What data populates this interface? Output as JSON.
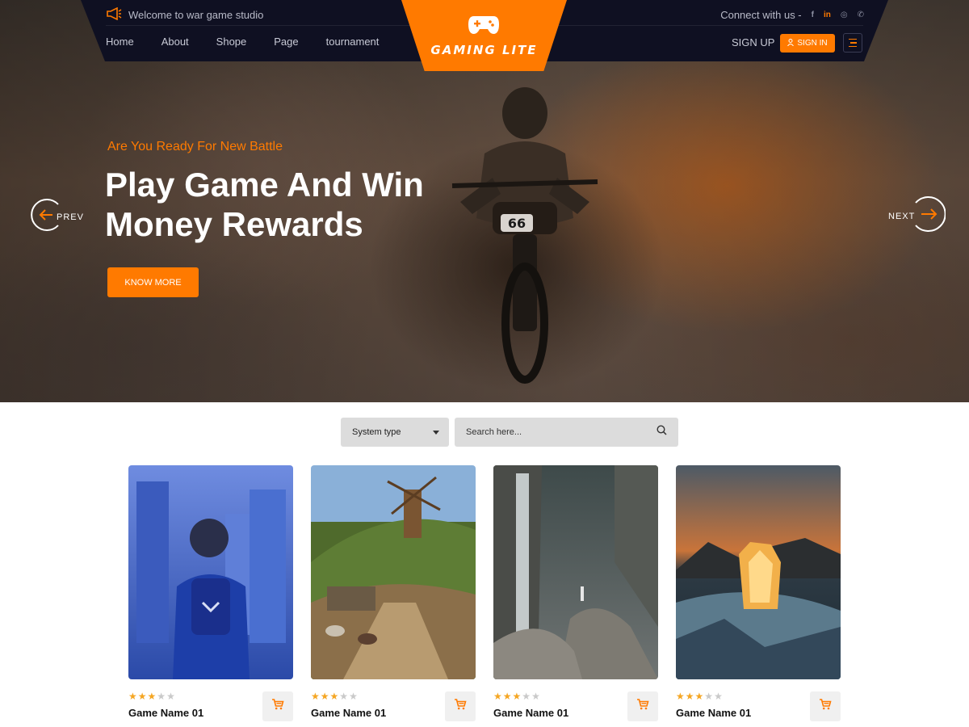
{
  "topbar": {
    "welcome": "Welcome to war game studio",
    "connect": "Connect with us -",
    "social": [
      "f",
      "in",
      "◎",
      "✆"
    ]
  },
  "nav": {
    "items": [
      "Home",
      "About",
      "Shope",
      "Page",
      "tournament"
    ],
    "signup": "SIGN UP",
    "signin": "SIGN IN"
  },
  "logo": {
    "text": "GAMING LITE"
  },
  "hero": {
    "kicker": "Are You Ready For New Battle",
    "headline_line1": "Play Game And Win",
    "headline_line2": "Money Rewards",
    "cta": "KNOW MORE",
    "prev": "PREV",
    "next": "NEXT"
  },
  "filter": {
    "system_label": "System type",
    "search_placeholder": "Search here..."
  },
  "cards": [
    {
      "title": "Game Name 01",
      "rating": 3,
      "max": 5
    },
    {
      "title": "Game Name 01",
      "rating": 3,
      "max": 5
    },
    {
      "title": "Game Name 01",
      "rating": 3,
      "max": 5
    },
    {
      "title": "Game Name 01",
      "rating": 3,
      "max": 5
    }
  ],
  "colors": {
    "accent": "#ff7a00",
    "header_bg": "#0f1022",
    "star": "#f5a623"
  },
  "icons": [
    "megaphone-icon",
    "gamepad-icon",
    "user-icon",
    "menu-icon",
    "arrow-left-icon",
    "arrow-right-icon",
    "search-icon",
    "cart-icon",
    "star-icon"
  ]
}
